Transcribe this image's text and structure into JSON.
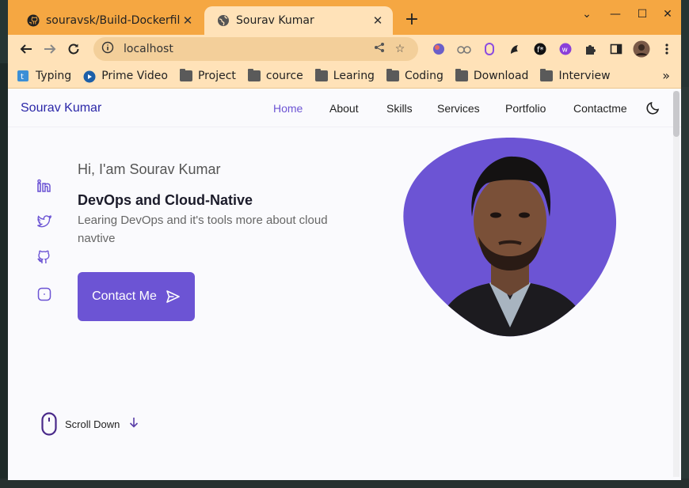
{
  "browser": {
    "tabs": [
      {
        "title": "souravsk/Build-Dockerfile",
        "icon": "github-icon",
        "active": false
      },
      {
        "title": "Sourav Kumar",
        "icon": "globe-icon",
        "active": true
      }
    ],
    "url": "localhost",
    "bookmarks": [
      {
        "label": "Typing",
        "icon": "typing-icon"
      },
      {
        "label": "Prime Video",
        "icon": "prime-video-icon"
      },
      {
        "label": "Project",
        "icon": "folder-icon"
      },
      {
        "label": "cource",
        "icon": "folder-icon"
      },
      {
        "label": "Learing",
        "icon": "folder-icon"
      },
      {
        "label": "Coding",
        "icon": "folder-icon"
      },
      {
        "label": "Download",
        "icon": "folder-icon"
      },
      {
        "label": "Interview",
        "icon": "folder-icon"
      }
    ],
    "colors": {
      "tabbar": "#f5a742",
      "toolbar": "#ffe2b8"
    }
  },
  "site": {
    "logo": "Sourav Kumar",
    "nav": [
      "Home",
      "About",
      "Skills",
      "Services",
      "Portfolio",
      "Contactme"
    ],
    "active_nav": "Home",
    "hero": {
      "greeting": "Hi, I'am Sourav Kumar",
      "role": "DevOps and Cloud-Native",
      "description": "Learing DevOps and it's tools more about cloud navtive",
      "cta": "Contact Me"
    },
    "social": [
      "linkedin-icon",
      "twitter-icon",
      "github-icon",
      "instagram-icon"
    ],
    "scroll_label": "Scroll Down",
    "accent": "#6c54d4"
  }
}
